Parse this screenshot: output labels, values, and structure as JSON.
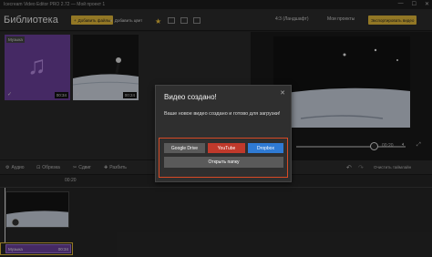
{
  "window": {
    "title": "Icecream Video Editor PRO 2.72 — Мой проект 1"
  },
  "header": {
    "library_title": "Библиотека",
    "add_files": "Добавить файлы",
    "add_color": "Добавить цвет",
    "ratio": "4:3 (Ландшафт)",
    "projects": "Мои проекты",
    "export": "Экспортировать видео"
  },
  "library": {
    "items": [
      {
        "label": "Музыка",
        "duration": "00:34",
        "type": "audio"
      },
      {
        "label": "",
        "duration": "00:24",
        "type": "video"
      }
    ]
  },
  "preview": {
    "time": "00:20"
  },
  "toolbar": {
    "audio": "Аудио",
    "crop": "Обрезка",
    "cut": "Сдвиг",
    "split": "Разбить",
    "clear_timeline": "Очистить таймлайн"
  },
  "timeline": {
    "ruler_time": "00:20",
    "music_label": "Музыка",
    "music_duration": "00:34"
  },
  "dialog": {
    "title": "Видео создано!",
    "text": "Ваше новое видео создано и готово для загрузки!",
    "google_drive": "Google Drive",
    "youtube": "YouTube",
    "dropbox": "Dropbox",
    "open_folder": "Открыть папку"
  },
  "colors": {
    "accent": "#e0b73a",
    "music": "#6b3f9a",
    "youtube": "#c0392b",
    "dropbox": "#2f7ad3",
    "highlight": "#d74a25"
  }
}
